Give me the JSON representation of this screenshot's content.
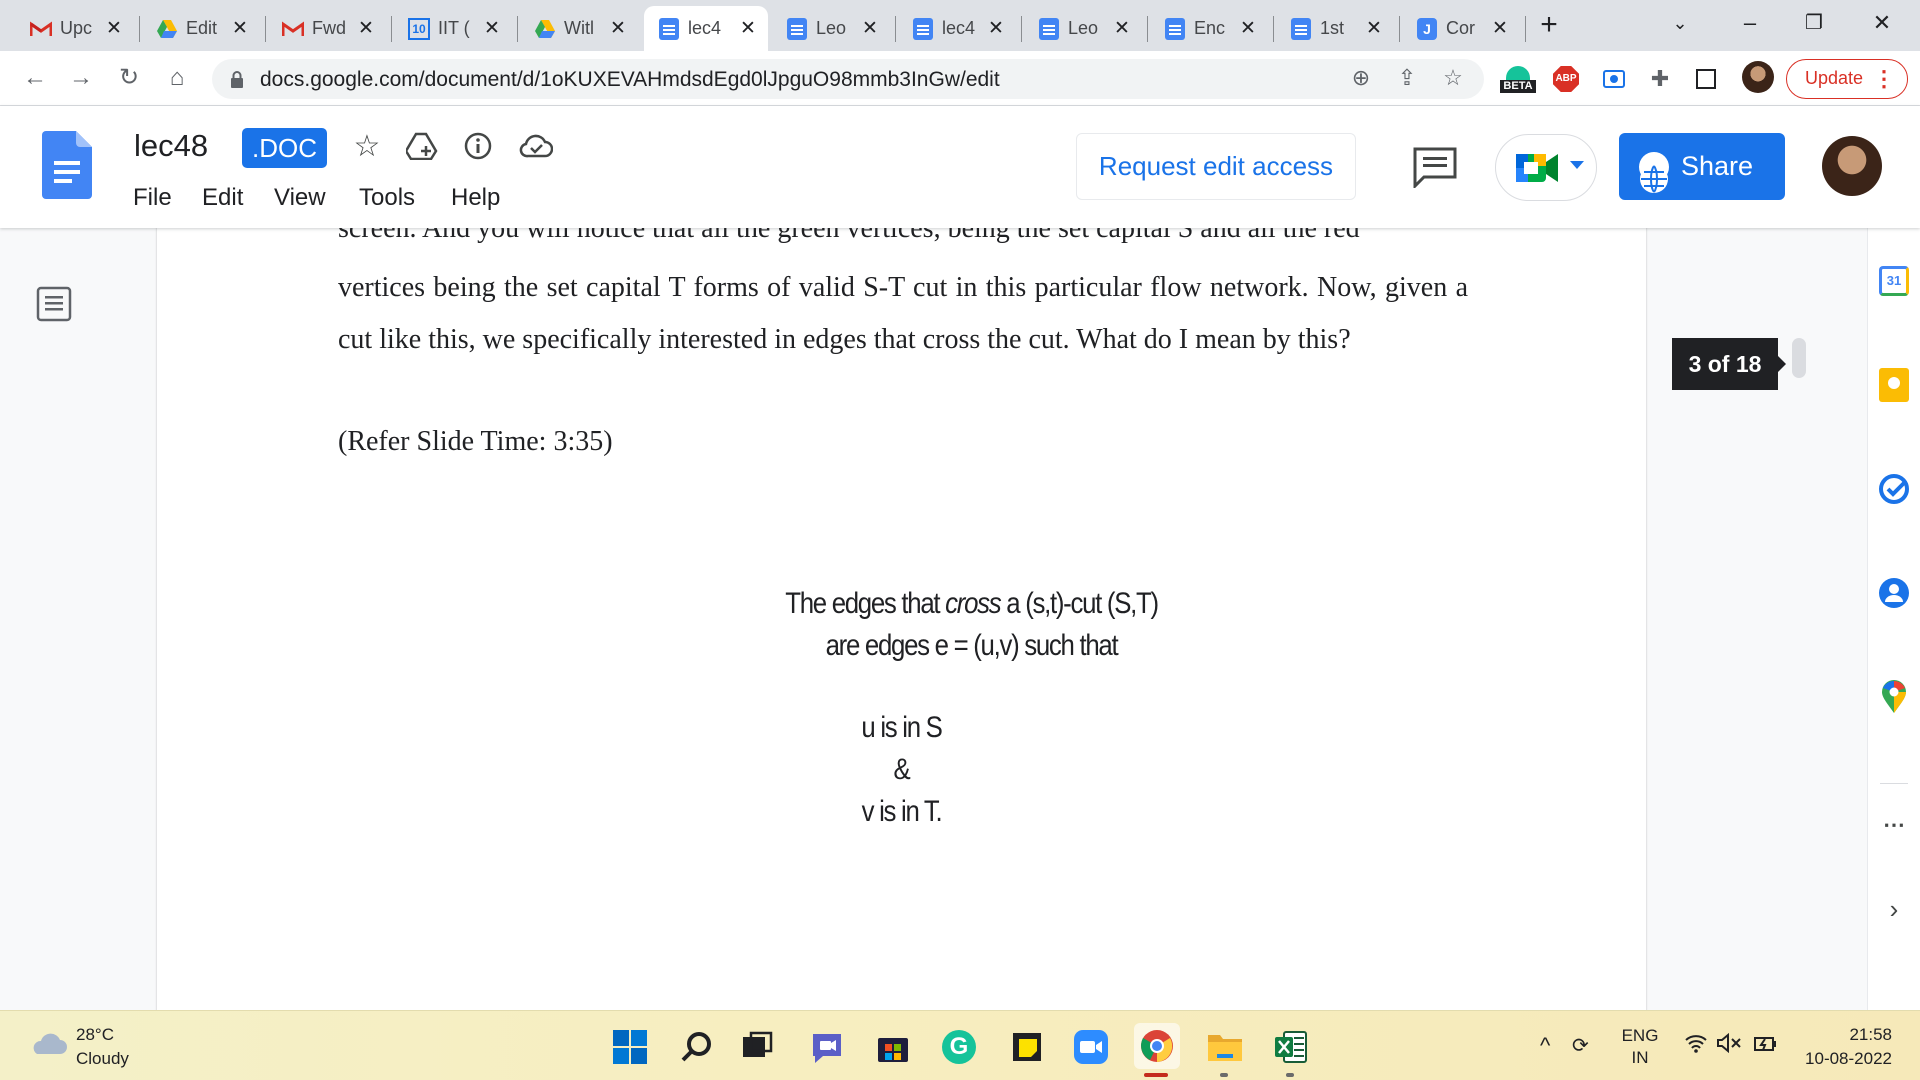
{
  "browser": {
    "tabs": [
      {
        "title": "Upc",
        "icon": "gmail-icon"
      },
      {
        "title": "Edit",
        "icon": "drive-icon"
      },
      {
        "title": "Fwd",
        "icon": "gmail-icon"
      },
      {
        "title": "IIT (",
        "icon": "calendar-10-icon"
      },
      {
        "title": "Witl",
        "icon": "drive-icon"
      },
      {
        "title": "lec4",
        "icon": "docs-icon",
        "active": true
      },
      {
        "title": "Leo",
        "icon": "docs-icon"
      },
      {
        "title": "lec4",
        "icon": "docs-icon"
      },
      {
        "title": "Leo",
        "icon": "docs-icon"
      },
      {
        "title": "Enc",
        "icon": "docs-icon"
      },
      {
        "title": "1st",
        "icon": "docs-icon"
      },
      {
        "title": "Cor",
        "icon": "jamboard-icon"
      }
    ],
    "url": "docs.google.com/document/d/1oKUXEVAHmdsdEgd0lJpguO98mmb3InGw/edit",
    "update_label": "Update",
    "tab_calendar_badge": "10",
    "extensions": {
      "abp": "ABP",
      "beta": "BETA"
    }
  },
  "docs": {
    "title": "lec48",
    "badge": ".DOC",
    "menu": [
      "File",
      "Edit",
      "View",
      "Tools",
      "Help"
    ],
    "request_edit": "Request edit access",
    "share": "Share"
  },
  "content": {
    "cutoff_line": "screen. And you will notice that all the green vertices, being the set capital S and all the red",
    "paragraph": "vertices being the set capital T forms of valid S-T cut in this particular flow network. Now, given a cut like this, we specifically interested in edges that cross the cut. What do I mean by this?",
    "refer": "(Refer Slide Time: 3:35)",
    "slide": {
      "line1_pre": "The edges that ",
      "line1_em": "cross",
      "line1_post": " a (s,t)-cut (S,T)",
      "line2": "are edges e = (u,v) such that",
      "line3": "u is in S",
      "line4": "&",
      "line5": "v is in T."
    },
    "page_indicator": "3 of 18"
  },
  "side_panel": {
    "calendar_day": "31"
  },
  "taskbar": {
    "temperature": "28°C",
    "condition": "Cloudy",
    "lang_top": "ENG",
    "lang_bottom": "IN",
    "time": "21:58",
    "date": "10-08-2022"
  },
  "colors": {
    "accent": "#1a73e8",
    "update_red": "#d93025",
    "tab_bg": "#dee1e6"
  }
}
